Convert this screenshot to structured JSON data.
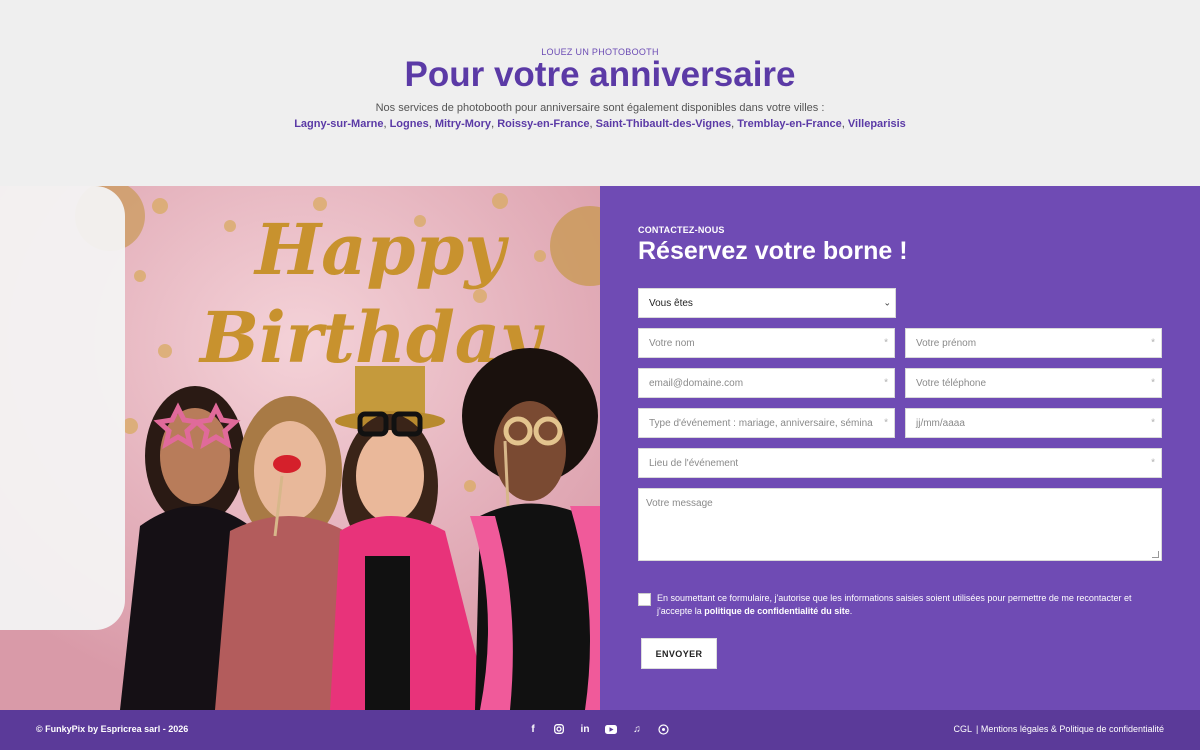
{
  "header": {
    "eyebrow": "LOUEZ UN PHOTOBOOTH",
    "title": "Pour votre anniversaire",
    "subtitle": "Nos services de photobooth pour anniversaire sont également disponibles dans votre villes :",
    "cities": [
      "Lagny-sur-Marne",
      "Lognes",
      "Mitry-Mory",
      "Roissy-en-France",
      "Saint-Thibault-des-Vignes",
      "Tremblay-en-France",
      "Villeparisis"
    ]
  },
  "photo": {
    "banner_line1": "Happy",
    "banner_line2": "Birthday"
  },
  "form": {
    "eyebrow": "CONTACTEZ-NOUS",
    "title": "Réservez votre borne !",
    "select_value": "Vous êtes",
    "name_placeholder": "Votre nom",
    "firstname_placeholder": "Votre prénom",
    "email_placeholder": "email@domaine.com",
    "phone_placeholder": "Votre téléphone",
    "event_type_placeholder": "Type d'événement : mariage, anniversaire, sémina",
    "date_placeholder": "jj/mm/aaaa",
    "location_placeholder": "Lieu de l'événement",
    "message_placeholder": "Votre message",
    "required_mark": "*",
    "consent_text": "En soumettant ce formulaire, j'autorise que les informations saisies soient utilisées pour permettre de me recontacter et j'accepte la ",
    "consent_link": "politique de confidentialité du site",
    "consent_end": ".",
    "submit_label": "ENVOYER"
  },
  "footer": {
    "copyright": "© FunkyPix by Espricrea sarl - 2026",
    "social_icons": [
      "facebook-icon",
      "instagram-icon",
      "linkedin-icon",
      "youtube-icon",
      "tiktok-icon",
      "whatsapp-icon"
    ],
    "legal_cgl": "CGL",
    "legal_links": "| Mentions légales & Politique de confidentialité"
  },
  "colors": {
    "brand_purple": "#6f4bb4",
    "title_purple": "#5b3aa6",
    "footer_purple": "#5b3a99"
  }
}
